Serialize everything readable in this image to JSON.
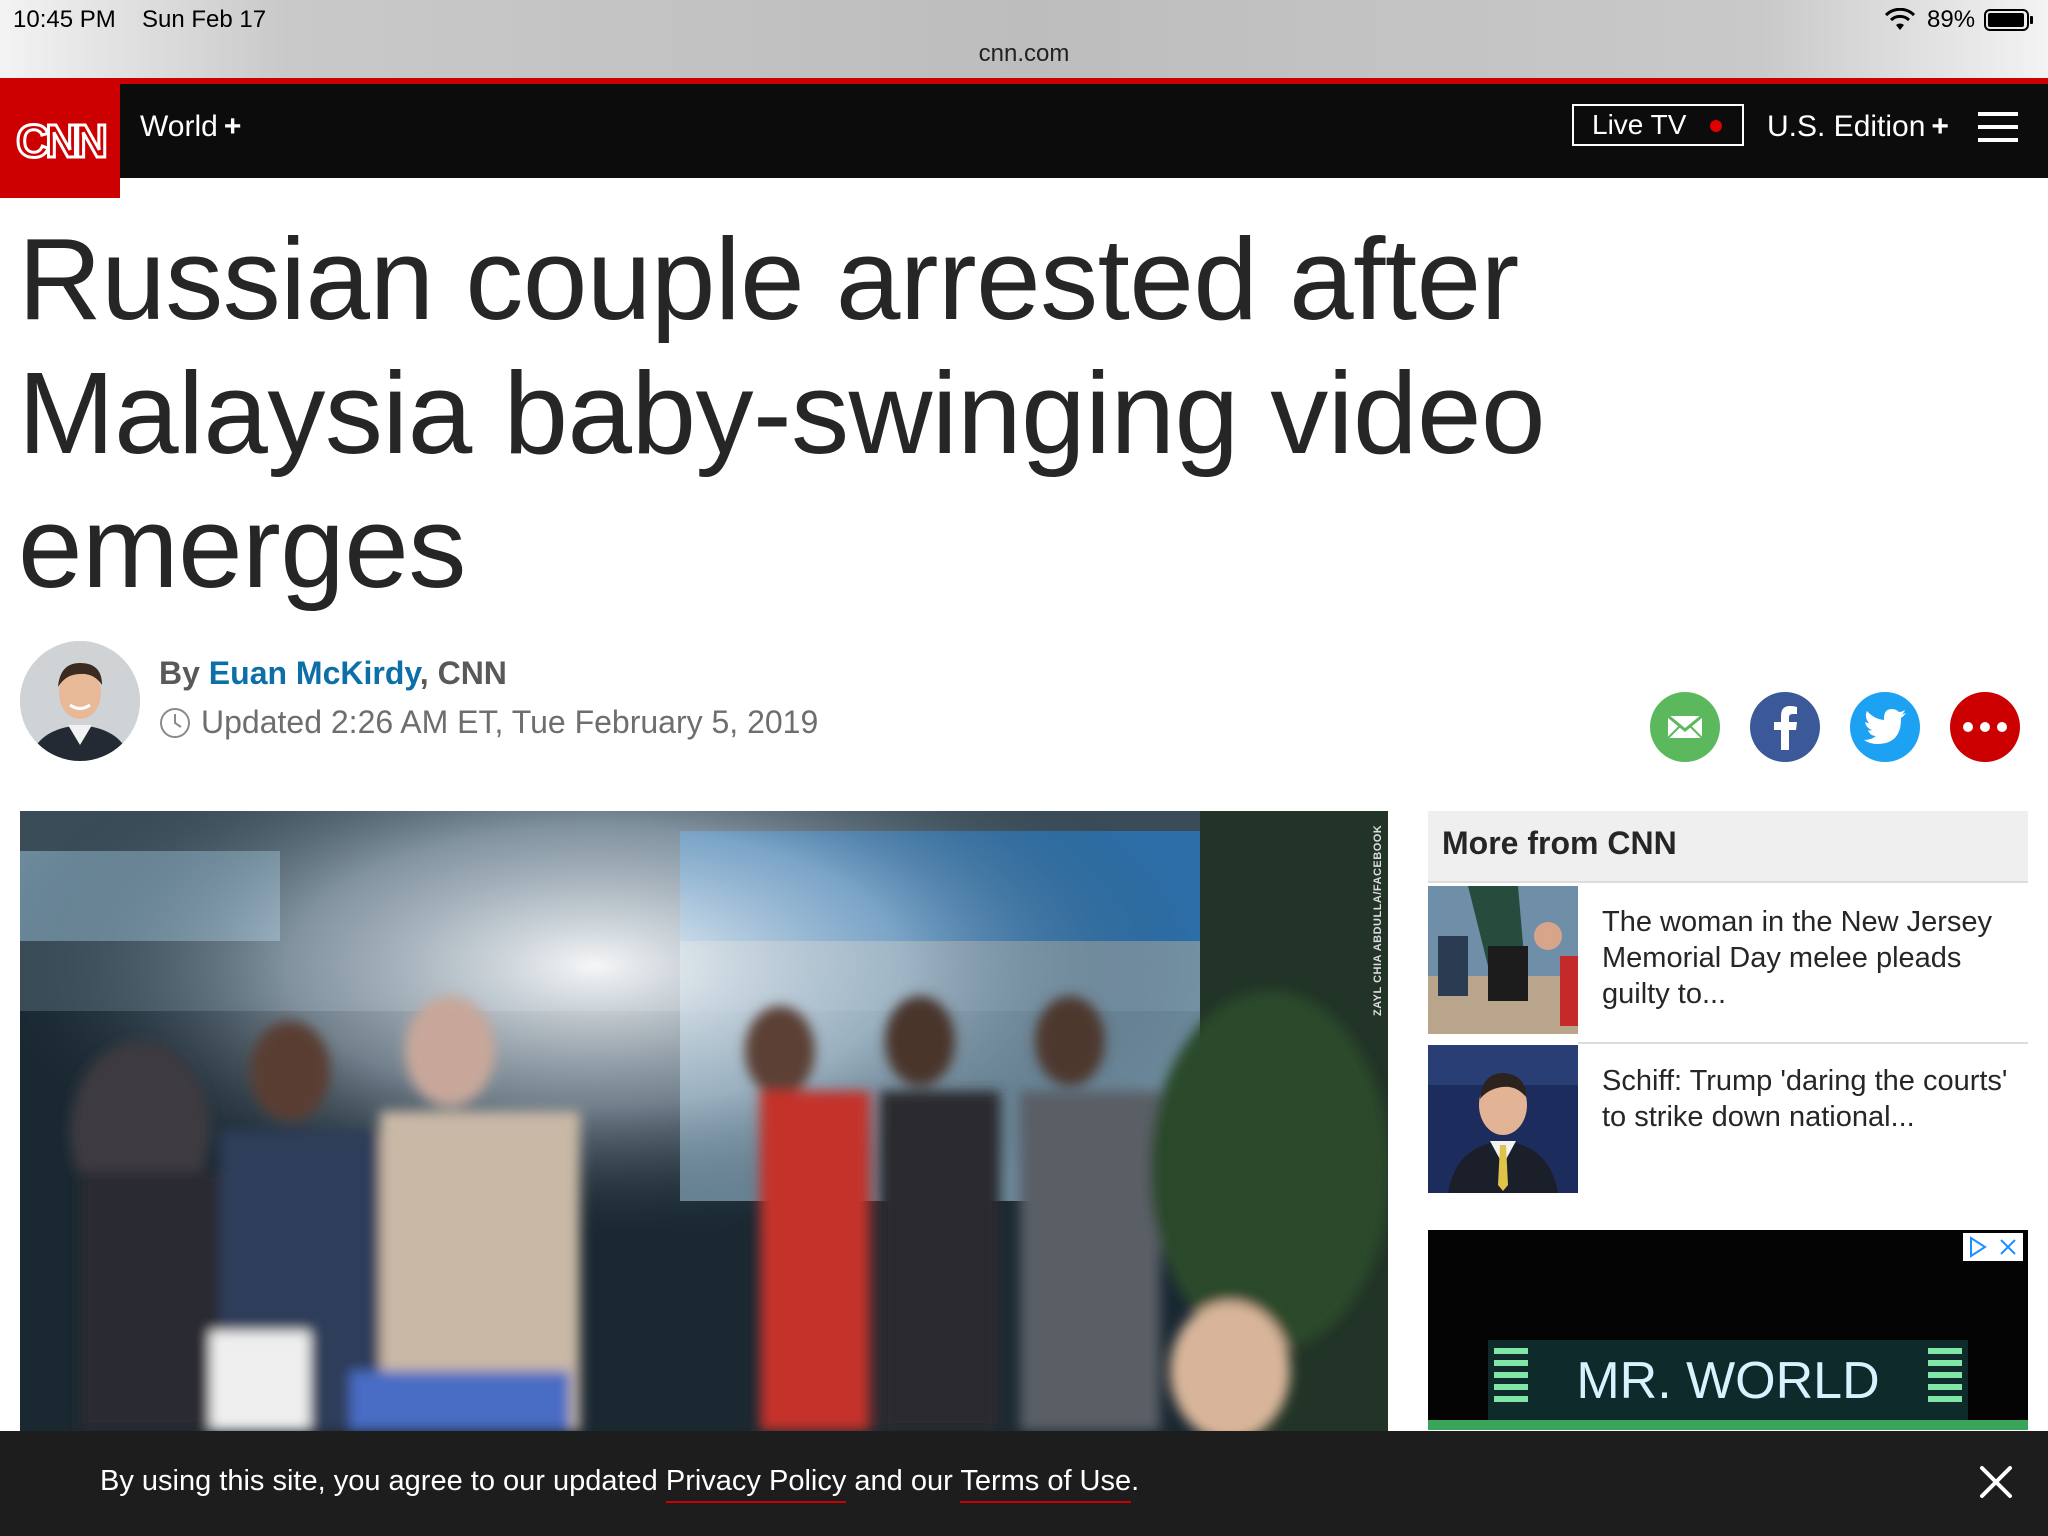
{
  "status_bar": {
    "time": "10:45 PM",
    "date": "Sun Feb 17",
    "battery": "89%",
    "url": "cnn.com"
  },
  "nav": {
    "logo_text": "CNN",
    "section": "World",
    "section_plus": "+",
    "live_tv": "Live TV",
    "edition": "U.S. Edition",
    "edition_plus": "+"
  },
  "article": {
    "headline": "Russian couple arrested after Malaysia baby-swinging video emerges",
    "byline_prefix": "By",
    "author": "Euan McKirdy",
    "outlet": ", CNN",
    "updated": "Updated 2:26 AM ET, Tue February 5, 2019",
    "photo_credit": "ZAYL CHIA ABDULLA/FACEBOOK"
  },
  "share": {
    "email_color": "#5cb85c",
    "facebook_color": "#3b5998",
    "twitter_color": "#1da1f2",
    "more_color": "#cc0000"
  },
  "more_from_cnn": {
    "heading": "More from CNN",
    "items": [
      {
        "text": "The woman in the New Jersey Memorial Day melee pleads guilty to..."
      },
      {
        "text": "Schiff: Trump 'daring the courts' to strike down national..."
      }
    ]
  },
  "ad": {
    "sign_text": "MR. WORLD"
  },
  "cookie_banner": {
    "text_before": "By using this site, you agree to our updated ",
    "privacy": "Privacy Policy",
    "text_middle": " and our ",
    "terms": "Terms of Use",
    "text_after": "."
  }
}
